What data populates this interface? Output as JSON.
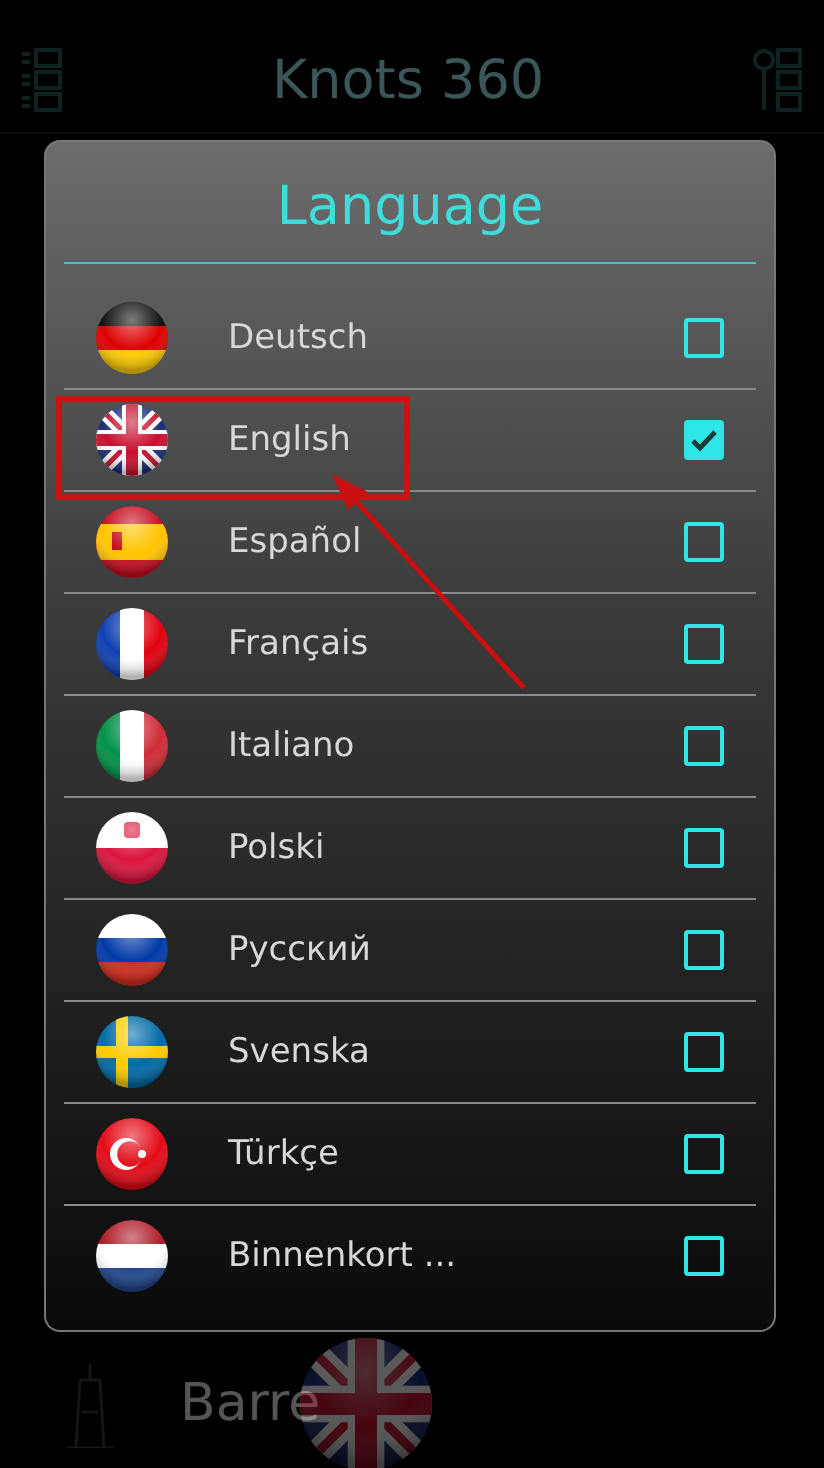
{
  "app_bar": {
    "title": "Knots 360"
  },
  "background_row": {
    "label": "Barre"
  },
  "dialog": {
    "title": "Language",
    "languages": [
      {
        "name": "Deutsch",
        "checked": false
      },
      {
        "name": "English",
        "checked": true
      },
      {
        "name": "Español",
        "checked": false
      },
      {
        "name": "Français",
        "checked": false
      },
      {
        "name": "Italiano",
        "checked": false
      },
      {
        "name": "Polski",
        "checked": false
      },
      {
        "name": "Русский",
        "checked": false
      },
      {
        "name": "Svenska",
        "checked": false
      },
      {
        "name": "Türkçe",
        "checked": false
      },
      {
        "name": "Binnenkort ...",
        "checked": false
      }
    ]
  }
}
